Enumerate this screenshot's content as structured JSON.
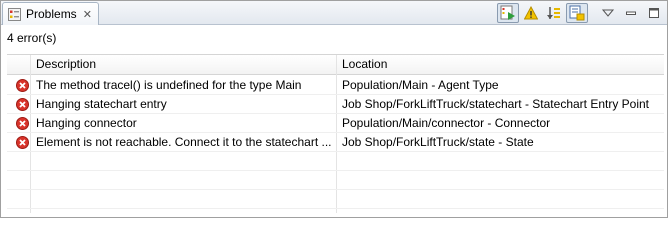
{
  "tab": {
    "label": "Problems",
    "close": "✕"
  },
  "status": {
    "text": "4 error(s)"
  },
  "columns": {
    "description": "Description",
    "location": "Location"
  },
  "rows": [
    {
      "description": "The method tracel() is undefined for the type Main",
      "location": "Population/Main - Agent Type"
    },
    {
      "description": "Hanging statechart entry",
      "location": "Job Shop/ForkLiftTruck/statechart - Statechart Entry Point"
    },
    {
      "description": "Hanging connector",
      "location": "Population/Main/connector - Connector"
    },
    {
      "description": "Element is not reachable. Connect it to the statechart ...",
      "location": "Job Shop/ForkLiftTruck/state - State"
    }
  ],
  "colors": {
    "error": "#d9342b",
    "accent": "#e3e8ef"
  },
  "icons": {
    "tab": "problems-icon",
    "toolbar": [
      "run-filter-icon",
      "warning-icon",
      "sort-icon",
      "link-editor-icon",
      "view-menu-icon",
      "minimize-icon",
      "maximize-icon"
    ],
    "row": "error-icon"
  }
}
